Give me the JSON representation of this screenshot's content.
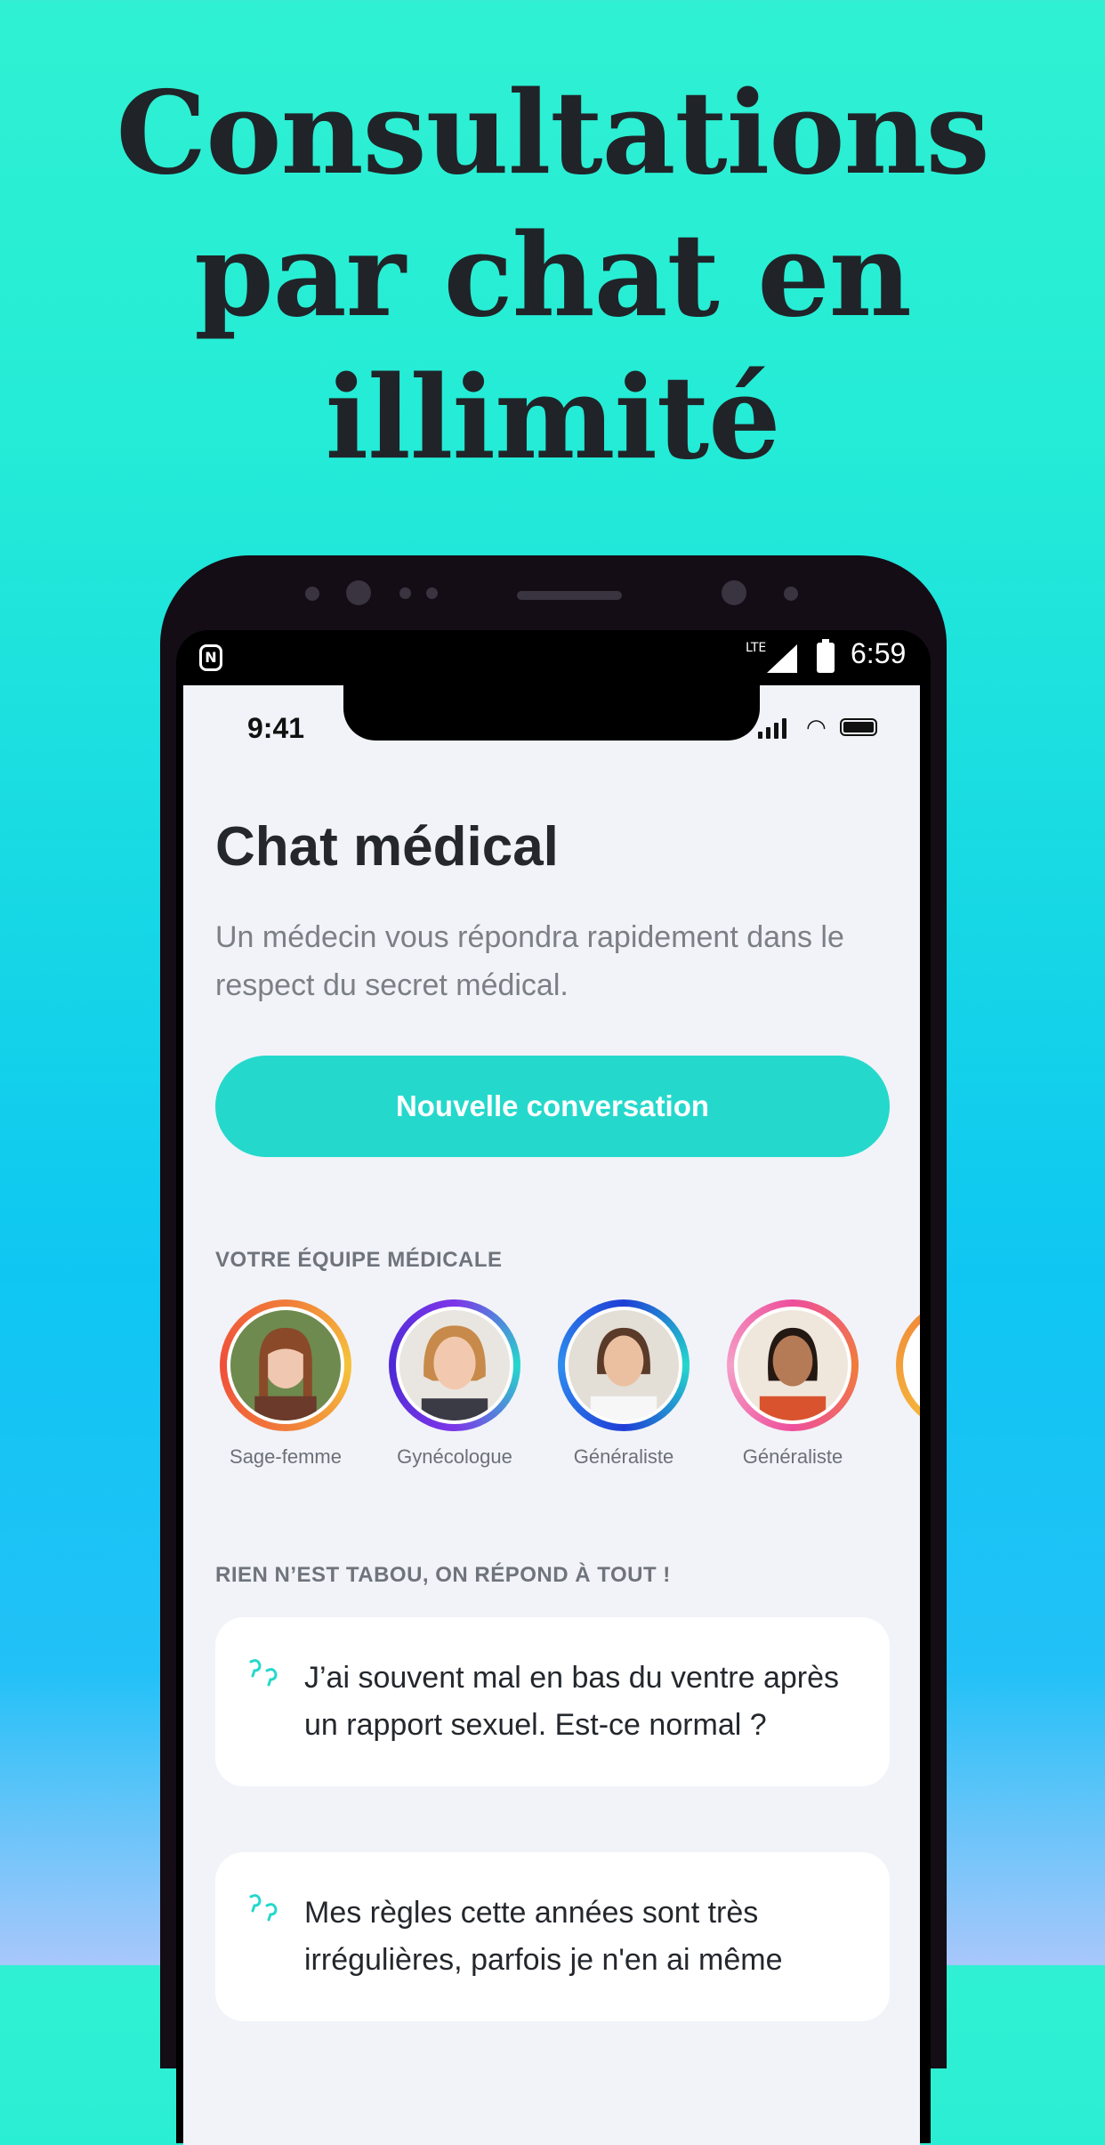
{
  "headline": {
    "line1": "Consultations",
    "line2": "par chat en",
    "line3": "illimité"
  },
  "android_status": {
    "network": "LTE",
    "time": "6:59"
  },
  "ios_status": {
    "time": "9:41"
  },
  "screen": {
    "title": "Chat médical",
    "subtitle": "Un médecin vous répondra rapidement dans le respect du secret médical.",
    "cta_label": "Nouvelle conversation",
    "team_heading": "VOTRE ÉQUIPE MÉDICALE",
    "team": [
      {
        "label": "Sage-femme",
        "ring": "#f07c3a"
      },
      {
        "label": "Gynécologue",
        "ring": "#7d36e8"
      },
      {
        "label": "Généraliste",
        "ring": "#1f3fd6"
      },
      {
        "label": "Généraliste",
        "ring": "#ee4f9c"
      }
    ],
    "faq_heading": "RIEN N’EST TABOU, ON RÉPOND À TOUT !",
    "questions": [
      "J’ai souvent mal en bas du ventre après un rapport sexuel. Est-ce normal ?",
      "Mes règles cette années sont très irrégulières, parfois je n'en ai même"
    ]
  },
  "colors": {
    "accent": "#25d8cc",
    "heading": "#24272c",
    "muted": "#7b7f86"
  }
}
